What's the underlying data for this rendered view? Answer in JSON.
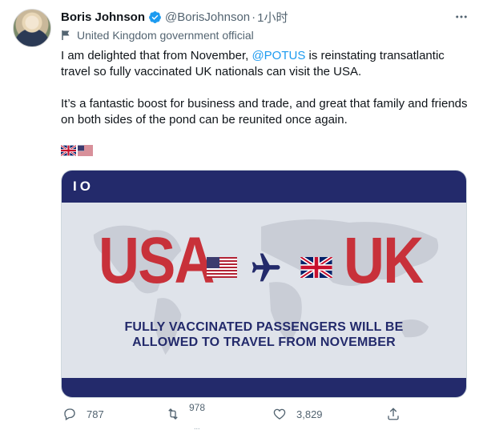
{
  "author": {
    "name": "Boris Johnson",
    "handle": "@BorisJohnson",
    "separator": "·",
    "time": "1小时"
  },
  "label": "United Kingdom government official",
  "tweet": {
    "mention": "@POTUS",
    "line1_before": "I am delighted that from November, ",
    "line1_after": " is reinstating transatlantic travel so fully vaccinated UK nationals can visit the USA.",
    "paragraph2": "It’s a fantastic boost for business and trade, and great that family and friends on both sides of the pond can be reunited once again."
  },
  "media": {
    "brand": "IO",
    "left_word": "USA",
    "right_word": "UK",
    "caption_line1": "FULLY VACCINATED PASSENGERS WILL BE",
    "caption_line2": "ALLOWED TO TRAVEL FROM NOVEMBER",
    "colors": {
      "navy": "#232a6b",
      "red": "#c8313a",
      "background": "#dfe3ea"
    }
  },
  "actions": {
    "replies": "787",
    "retweets": "978",
    "retweets_extra": "...",
    "likes": "3,829"
  },
  "icons": [
    "verified-badge-icon",
    "government-flag-icon",
    "more-options-icon",
    "reply-icon",
    "retweet-icon",
    "like-icon",
    "share-icon",
    "plane-icon",
    "uk-flag-icon",
    "us-flag-icon"
  ],
  "colors": {
    "link": "#1d9bf0",
    "muted": "#536471",
    "text": "#0f1419"
  }
}
